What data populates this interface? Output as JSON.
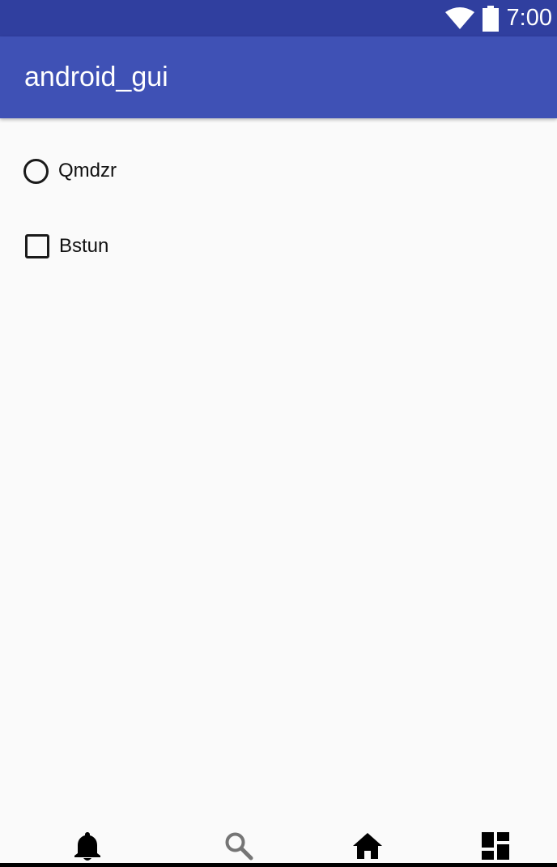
{
  "status_bar": {
    "time": "7:00",
    "icons": [
      "wifi-icon",
      "battery-icon"
    ],
    "color": "#303f9f"
  },
  "app_bar": {
    "title": "android_gui",
    "color": "#3f51b5"
  },
  "options": {
    "radio": {
      "label": "Qmdzr",
      "checked": false
    },
    "checkbox": {
      "label": "Bstun",
      "checked": false
    }
  },
  "bottom_nav": {
    "items": [
      {
        "icon": "bell-icon",
        "active": true
      },
      {
        "icon": "search-icon",
        "active": false
      },
      {
        "icon": "home-icon",
        "active": true
      },
      {
        "icon": "dashboard-icon",
        "active": true
      }
    ]
  }
}
